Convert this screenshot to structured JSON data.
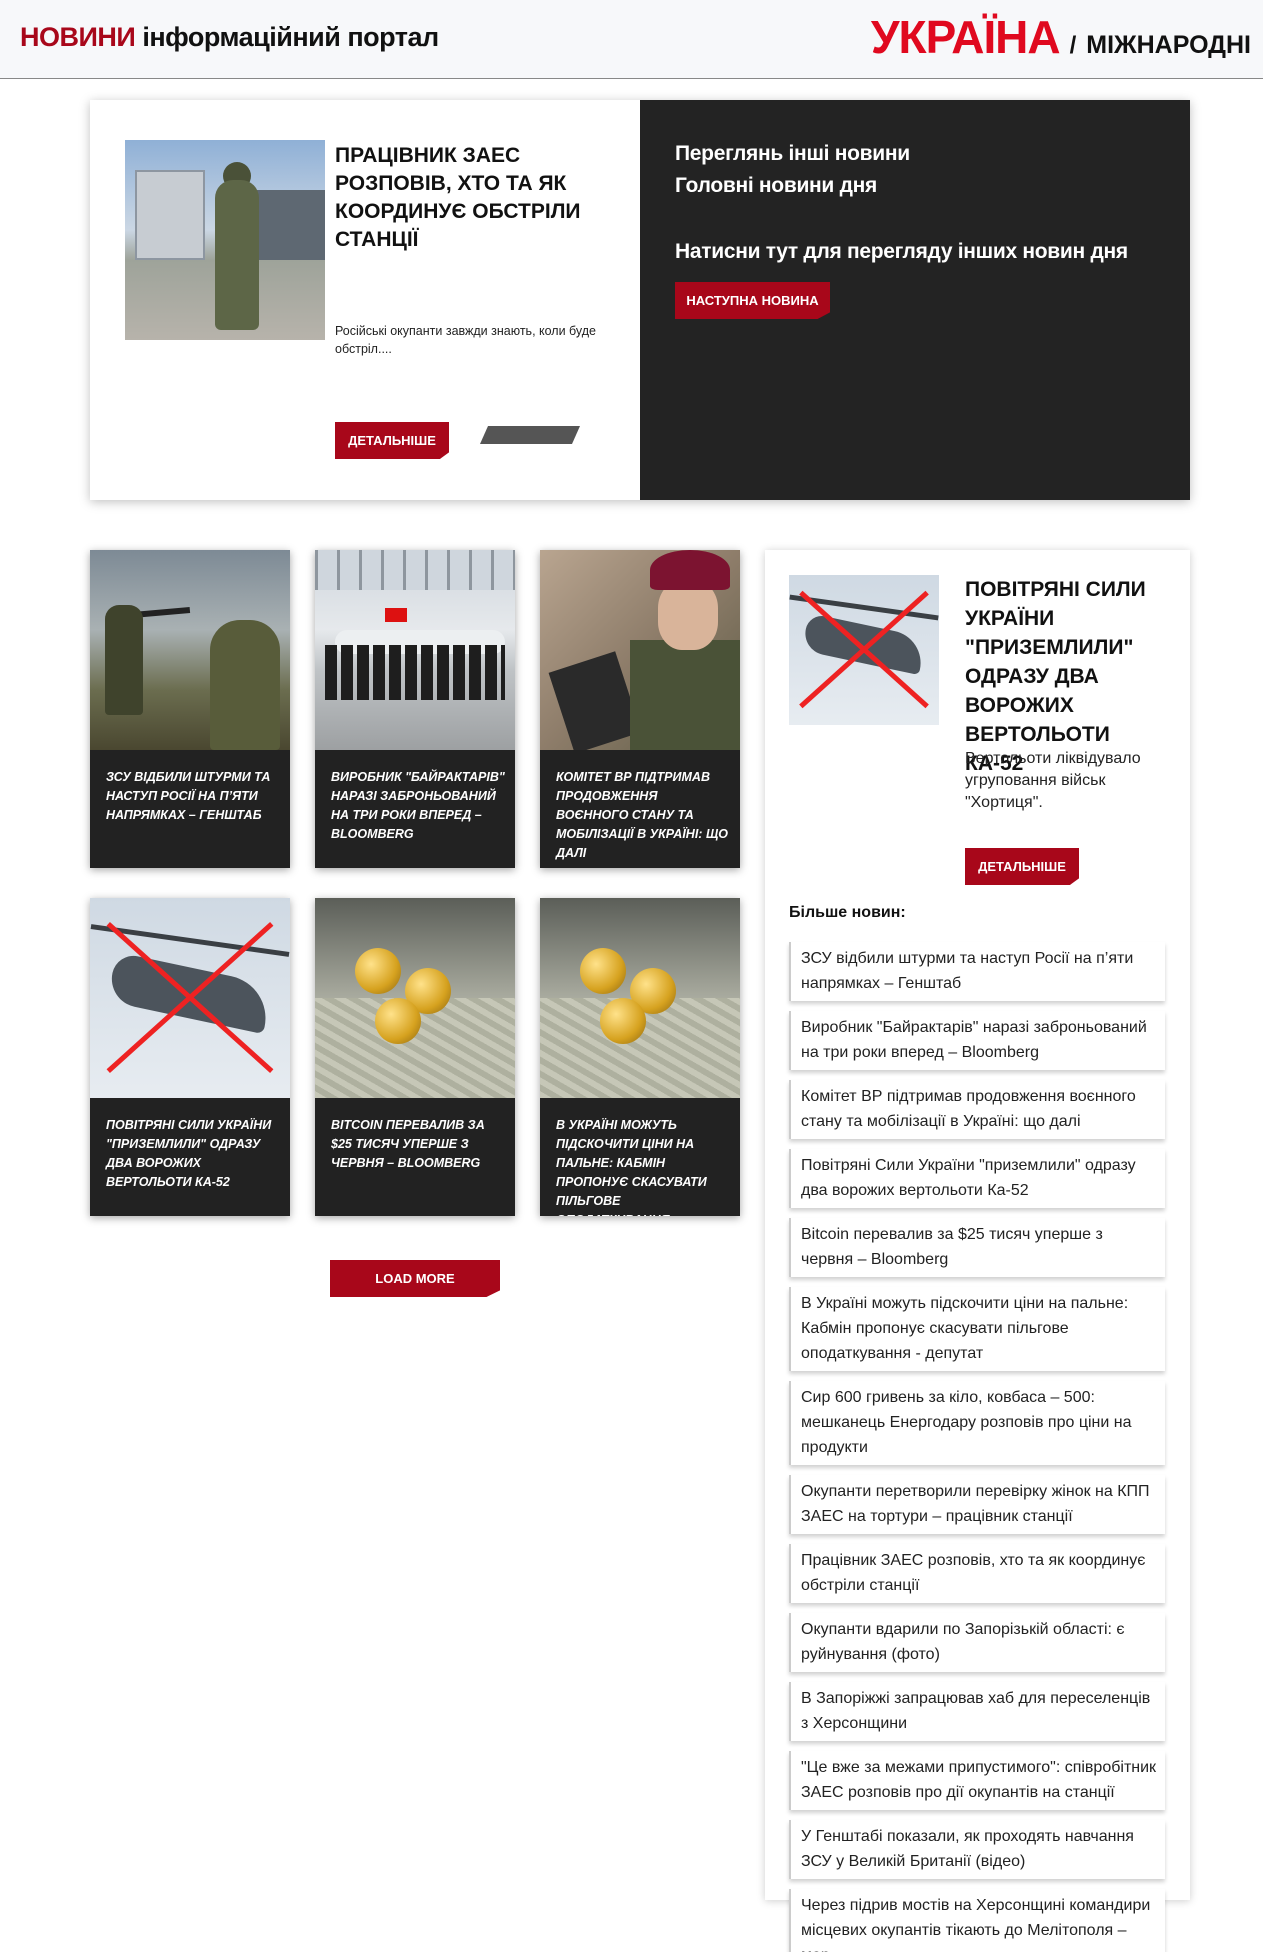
{
  "header": {
    "brand_accent": "НОВИНИ",
    "brand_rest": "інформаційний портал",
    "country": "УКРАЇНА",
    "separator": "/",
    "international": "МІЖНАРОДНІ"
  },
  "hero": {
    "title": "Працівник ЗАЕС розповів, хто та як координує обстріли станції",
    "excerpt": "Російські окупанти завжди знають, коли буде обстріл....",
    "more_label": "Детальніше",
    "right_line1": "Переглянь інші новини",
    "right_line2": "Головні новини дня",
    "right_line3": "Натисни тут для перегляду інших новин дня",
    "next_label": "Наступна новина"
  },
  "cards": [
    {
      "caption": "ЗСУ відбили штурми та наступ Росії на п’яти напрямках – Генштаб"
    },
    {
      "caption": "Виробник \"Байрактарів\" наразі заброньований на три роки вперед – Bloomberg"
    },
    {
      "caption": "Комітет ВР підтримав продовження воєнного стану та мобілізації в Україні: що далі"
    },
    {
      "caption": "Повітряні Сили України \"приземлили\" одразу два ворожих вертольоти Ка-52"
    },
    {
      "caption": "Bitcoin перевалив за $25 тисяч уперше з червня – Bloomberg"
    },
    {
      "caption": "В Україні можуть підскочити ціни на пальне: Кабмін пропонує скасувати пільгове оподаткування - депутат"
    }
  ],
  "load_more_label": "LOAD MORE",
  "sidebar": {
    "title": "Повітряні Сили України \"приземлили\" одразу два ворожих вертольоти Ка-52",
    "excerpt": "Вертольоти ліквідувало угруповання військ \"Хортиця\".",
    "more_label": "Детальніше",
    "more_news_title": "Більше новин:",
    "items": [
      "ЗСУ відбили штурми та наступ Росії на п’яти напрямках – Генштаб",
      "Виробник \"Байрактарів\" наразі заброньований на три роки вперед – Bloomberg",
      "Комітет ВР підтримав продовження воєнного стану та мобілізації в Україні: що далі",
      "Повітряні Сили України \"приземлили\" одразу два ворожих вертольоти Ка-52",
      "Bitcoin перевалив за $25 тисяч уперше з червня – Bloomberg",
      "В Україні можуть підскочити ціни на пальне: Кабмін пропонує скасувати пільгове оподаткування - депутат",
      "Сир 600 гривень за кіло, ковбаса – 500: мешканець Енергодару розповів про ціни на продукти",
      "Окупанти перетворили перевірку жінок на КПП ЗАЕС на тортури – працівник станції",
      "Працівник ЗАЕС розповів, хто та як координує обстріли станції",
      "Окупанти вдарили по Запорізькій області: є руйнування (фото)",
      "В Запоріжжі запрацював хаб для переселенців з Херсонщини",
      "\"Це вже за межами припустимого\": співробітник ЗАЕС розповів про дії окупантів на станції",
      "У Генштабі показали, як проходять навчання ЗСУ у Великій Британії (відео)",
      "Через підрив мостів на Херсонщині командири місцевих окупантів тікають до Мелітополя – мер"
    ]
  },
  "colors": {
    "accent_red": "#a8071a",
    "brand_red": "#e0091f",
    "dark_panel": "#232323"
  }
}
